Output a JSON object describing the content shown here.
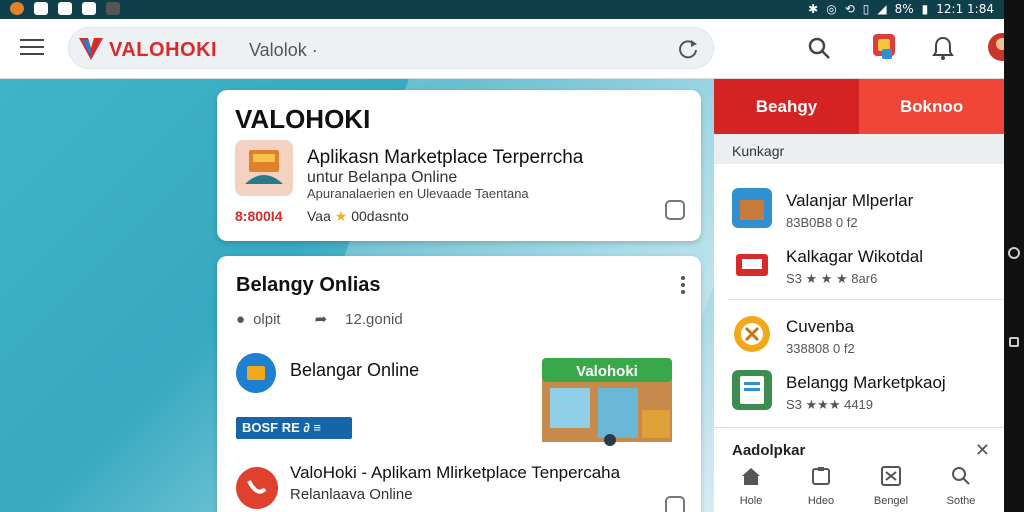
{
  "status_bar": {
    "battery": "8%",
    "time": "12:1 1:84"
  },
  "header": {
    "brand": "VALOHOKI",
    "search_text": "Valolok",
    "search_suffix": "·"
  },
  "card1": {
    "title": "VALOHOKI",
    "line1": "Aplikasn Marketplace Terperrcha",
    "line2": "untur Belanpa Online",
    "line3": "Apuranalaerien en Ulevaade Taentana",
    "price": "8:800I4",
    "meta_prefix": "Vaa",
    "meta_value": "00dasnto"
  },
  "card2": {
    "title": "Belangy Onlias",
    "meta_left": "olpit",
    "meta_right": "12.gonid",
    "item_label": "Belangar Online",
    "badge": "BOSF RE ∂ ≡",
    "store_sign": "Valohoki",
    "row2_title": "ValoHoki - Aplikam Mlirketplace  Tenpercaha",
    "row2_sub": "Relanlaava Online"
  },
  "right_panel": {
    "tabs": [
      {
        "label": "Beahgy"
      },
      {
        "label": "Boknoo"
      }
    ],
    "section_label": "Kunkagr",
    "items": [
      {
        "title": "Valanjar Mlperlar",
        "sub": "83B0B8 0 f2",
        "icon_color": "#2f8fd1"
      },
      {
        "title": "Kalkagar Wikotdal",
        "sub": "S3 ★ ★ ★ 8ar6",
        "icon_color": "#d62b2b"
      },
      {
        "title": "Cuvenba",
        "sub": "338808 0 f2",
        "icon_color": "#f2a818"
      },
      {
        "title": "Belangg Marketpkaoj",
        "sub": "S3 ★★★ 4419",
        "icon_color": "#3c8d52"
      }
    ],
    "bottom_sheet_title": "Aadolpkar",
    "bottom_nav": [
      {
        "label": "Hole",
        "icon": "home-icon"
      },
      {
        "label": "Hdeo",
        "icon": "tag-icon"
      },
      {
        "label": "Bengel",
        "icon": "grid-icon"
      },
      {
        "label": "Sothe",
        "icon": "search-icon"
      }
    ]
  },
  "colors": {
    "accent_red": "#d62b2b",
    "teal": "#3fb4c8",
    "status_bar": "#0f3f4a"
  }
}
